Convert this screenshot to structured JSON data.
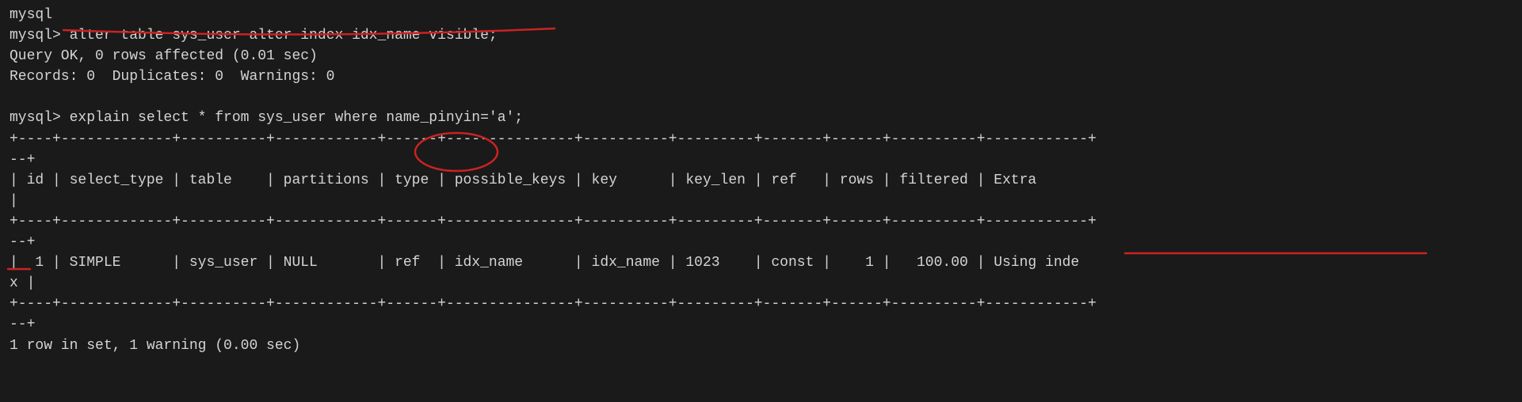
{
  "terminal": {
    "background": "#1a1a1a",
    "text_color": "#d4d4d4",
    "lines": [
      {
        "id": "mysql-prompt-1",
        "text": "mysql"
      },
      {
        "id": "alter-command",
        "text": "mysql> alter table sys_user alter index idx_name visible;"
      },
      {
        "id": "query-ok",
        "text": "Query OK, 0 rows affected (0.01 sec)"
      },
      {
        "id": "records",
        "text": "Records: 0  Duplicates: 0  Warnings: 0"
      },
      {
        "id": "blank-1",
        "text": ""
      },
      {
        "id": "explain-command",
        "text": "mysql> explain select * from sys_user where name_pinyin='a';"
      },
      {
        "id": "separator-top",
        "text": "+----+-------------+----------+------------+------+---------------+----------+---------+-------+------+----------+------------+"
      },
      {
        "id": "separator-cont",
        "text": "--+"
      },
      {
        "id": "header-row",
        "text": "| id | select_type | table    | partitions | type | possible_keys | key      | key_len | ref   | rows | filtered | Extra      "
      },
      {
        "id": "header-cont",
        "text": "|"
      },
      {
        "id": "separator-mid",
        "text": "+----+-------------+----------+------------+------+---------------+----------+---------+-------+------+----------+------------+"
      },
      {
        "id": "separator-mid-cont",
        "text": "--+"
      },
      {
        "id": "data-row",
        "text": "|  1 | SIMPLE      | sys_user | NULL       | ref  | idx_name      | idx_name | 1023    | const |    1 |   100.00 | Using inde"
      },
      {
        "id": "data-cont",
        "text": "x |"
      },
      {
        "id": "separator-bot",
        "text": "+----+-------------+----------+------------+------+---------------+----------+---------+-------+------+----------+------------+"
      },
      {
        "id": "separator-bot-cont",
        "text": "--+"
      },
      {
        "id": "result",
        "text": "1 row in set, 1 warning (0.00 sec)"
      },
      {
        "id": "blank-2",
        "text": ""
      },
      {
        "id": "cursor-line",
        "text": "    |"
      }
    ],
    "annotations": {
      "alter_underline": "Red curved underline under the alter table command",
      "type_circle": "Red circle around 'type' column header",
      "using_index_underline": "Red underline under 'Using index' in result row"
    }
  }
}
